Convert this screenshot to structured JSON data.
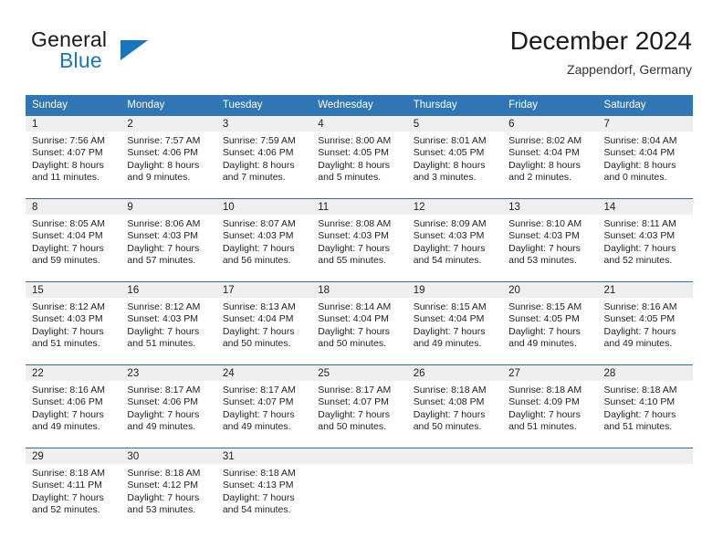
{
  "logo": {
    "word_one": "General",
    "word_two": "Blue",
    "accent_color": "#1b75bb"
  },
  "header": {
    "title": "December 2024",
    "subtitle": "Zappendorf, Germany"
  },
  "theme": {
    "header_blue": "#3075b4",
    "day_band_gray": "#efefef",
    "separator_blue": "#2f6fa8"
  },
  "weekday_headers": [
    "Sunday",
    "Monday",
    "Tuesday",
    "Wednesday",
    "Thursday",
    "Friday",
    "Saturday"
  ],
  "weeks": [
    [
      {
        "day": "1",
        "sunrise": "Sunrise: 7:56 AM",
        "sunset": "Sunset: 4:07 PM",
        "daylight_line1": "Daylight: 8 hours",
        "daylight_line2": "and 11 minutes."
      },
      {
        "day": "2",
        "sunrise": "Sunrise: 7:57 AM",
        "sunset": "Sunset: 4:06 PM",
        "daylight_line1": "Daylight: 8 hours",
        "daylight_line2": "and 9 minutes."
      },
      {
        "day": "3",
        "sunrise": "Sunrise: 7:59 AM",
        "sunset": "Sunset: 4:06 PM",
        "daylight_line1": "Daylight: 8 hours",
        "daylight_line2": "and 7 minutes."
      },
      {
        "day": "4",
        "sunrise": "Sunrise: 8:00 AM",
        "sunset": "Sunset: 4:05 PM",
        "daylight_line1": "Daylight: 8 hours",
        "daylight_line2": "and 5 minutes."
      },
      {
        "day": "5",
        "sunrise": "Sunrise: 8:01 AM",
        "sunset": "Sunset: 4:05 PM",
        "daylight_line1": "Daylight: 8 hours",
        "daylight_line2": "and 3 minutes."
      },
      {
        "day": "6",
        "sunrise": "Sunrise: 8:02 AM",
        "sunset": "Sunset: 4:04 PM",
        "daylight_line1": "Daylight: 8 hours",
        "daylight_line2": "and 2 minutes."
      },
      {
        "day": "7",
        "sunrise": "Sunrise: 8:04 AM",
        "sunset": "Sunset: 4:04 PM",
        "daylight_line1": "Daylight: 8 hours",
        "daylight_line2": "and 0 minutes."
      }
    ],
    [
      {
        "day": "8",
        "sunrise": "Sunrise: 8:05 AM",
        "sunset": "Sunset: 4:04 PM",
        "daylight_line1": "Daylight: 7 hours",
        "daylight_line2": "and 59 minutes."
      },
      {
        "day": "9",
        "sunrise": "Sunrise: 8:06 AM",
        "sunset": "Sunset: 4:03 PM",
        "daylight_line1": "Daylight: 7 hours",
        "daylight_line2": "and 57 minutes."
      },
      {
        "day": "10",
        "sunrise": "Sunrise: 8:07 AM",
        "sunset": "Sunset: 4:03 PM",
        "daylight_line1": "Daylight: 7 hours",
        "daylight_line2": "and 56 minutes."
      },
      {
        "day": "11",
        "sunrise": "Sunrise: 8:08 AM",
        "sunset": "Sunset: 4:03 PM",
        "daylight_line1": "Daylight: 7 hours",
        "daylight_line2": "and 55 minutes."
      },
      {
        "day": "12",
        "sunrise": "Sunrise: 8:09 AM",
        "sunset": "Sunset: 4:03 PM",
        "daylight_line1": "Daylight: 7 hours",
        "daylight_line2": "and 54 minutes."
      },
      {
        "day": "13",
        "sunrise": "Sunrise: 8:10 AM",
        "sunset": "Sunset: 4:03 PM",
        "daylight_line1": "Daylight: 7 hours",
        "daylight_line2": "and 53 minutes."
      },
      {
        "day": "14",
        "sunrise": "Sunrise: 8:11 AM",
        "sunset": "Sunset: 4:03 PM",
        "daylight_line1": "Daylight: 7 hours",
        "daylight_line2": "and 52 minutes."
      }
    ],
    [
      {
        "day": "15",
        "sunrise": "Sunrise: 8:12 AM",
        "sunset": "Sunset: 4:03 PM",
        "daylight_line1": "Daylight: 7 hours",
        "daylight_line2": "and 51 minutes."
      },
      {
        "day": "16",
        "sunrise": "Sunrise: 8:12 AM",
        "sunset": "Sunset: 4:03 PM",
        "daylight_line1": "Daylight: 7 hours",
        "daylight_line2": "and 51 minutes."
      },
      {
        "day": "17",
        "sunrise": "Sunrise: 8:13 AM",
        "sunset": "Sunset: 4:04 PM",
        "daylight_line1": "Daylight: 7 hours",
        "daylight_line2": "and 50 minutes."
      },
      {
        "day": "18",
        "sunrise": "Sunrise: 8:14 AM",
        "sunset": "Sunset: 4:04 PM",
        "daylight_line1": "Daylight: 7 hours",
        "daylight_line2": "and 50 minutes."
      },
      {
        "day": "19",
        "sunrise": "Sunrise: 8:15 AM",
        "sunset": "Sunset: 4:04 PM",
        "daylight_line1": "Daylight: 7 hours",
        "daylight_line2": "and 49 minutes."
      },
      {
        "day": "20",
        "sunrise": "Sunrise: 8:15 AM",
        "sunset": "Sunset: 4:05 PM",
        "daylight_line1": "Daylight: 7 hours",
        "daylight_line2": "and 49 minutes."
      },
      {
        "day": "21",
        "sunrise": "Sunrise: 8:16 AM",
        "sunset": "Sunset: 4:05 PM",
        "daylight_line1": "Daylight: 7 hours",
        "daylight_line2": "and 49 minutes."
      }
    ],
    [
      {
        "day": "22",
        "sunrise": "Sunrise: 8:16 AM",
        "sunset": "Sunset: 4:06 PM",
        "daylight_line1": "Daylight: 7 hours",
        "daylight_line2": "and 49 minutes."
      },
      {
        "day": "23",
        "sunrise": "Sunrise: 8:17 AM",
        "sunset": "Sunset: 4:06 PM",
        "daylight_line1": "Daylight: 7 hours",
        "daylight_line2": "and 49 minutes."
      },
      {
        "day": "24",
        "sunrise": "Sunrise: 8:17 AM",
        "sunset": "Sunset: 4:07 PM",
        "daylight_line1": "Daylight: 7 hours",
        "daylight_line2": "and 49 minutes."
      },
      {
        "day": "25",
        "sunrise": "Sunrise: 8:17 AM",
        "sunset": "Sunset: 4:07 PM",
        "daylight_line1": "Daylight: 7 hours",
        "daylight_line2": "and 50 minutes."
      },
      {
        "day": "26",
        "sunrise": "Sunrise: 8:18 AM",
        "sunset": "Sunset: 4:08 PM",
        "daylight_line1": "Daylight: 7 hours",
        "daylight_line2": "and 50 minutes."
      },
      {
        "day": "27",
        "sunrise": "Sunrise: 8:18 AM",
        "sunset": "Sunset: 4:09 PM",
        "daylight_line1": "Daylight: 7 hours",
        "daylight_line2": "and 51 minutes."
      },
      {
        "day": "28",
        "sunrise": "Sunrise: 8:18 AM",
        "sunset": "Sunset: 4:10 PM",
        "daylight_line1": "Daylight: 7 hours",
        "daylight_line2": "and 51 minutes."
      }
    ],
    [
      {
        "day": "29",
        "sunrise": "Sunrise: 8:18 AM",
        "sunset": "Sunset: 4:11 PM",
        "daylight_line1": "Daylight: 7 hours",
        "daylight_line2": "and 52 minutes."
      },
      {
        "day": "30",
        "sunrise": "Sunrise: 8:18 AM",
        "sunset": "Sunset: 4:12 PM",
        "daylight_line1": "Daylight: 7 hours",
        "daylight_line2": "and 53 minutes."
      },
      {
        "day": "31",
        "sunrise": "Sunrise: 8:18 AM",
        "sunset": "Sunset: 4:13 PM",
        "daylight_line1": "Daylight: 7 hours",
        "daylight_line2": "and 54 minutes."
      },
      {
        "day": "",
        "sunrise": "",
        "sunset": "",
        "daylight_line1": "",
        "daylight_line2": ""
      },
      {
        "day": "",
        "sunrise": "",
        "sunset": "",
        "daylight_line1": "",
        "daylight_line2": ""
      },
      {
        "day": "",
        "sunrise": "",
        "sunset": "",
        "daylight_line1": "",
        "daylight_line2": ""
      },
      {
        "day": "",
        "sunrise": "",
        "sunset": "",
        "daylight_line1": "",
        "daylight_line2": ""
      }
    ]
  ]
}
